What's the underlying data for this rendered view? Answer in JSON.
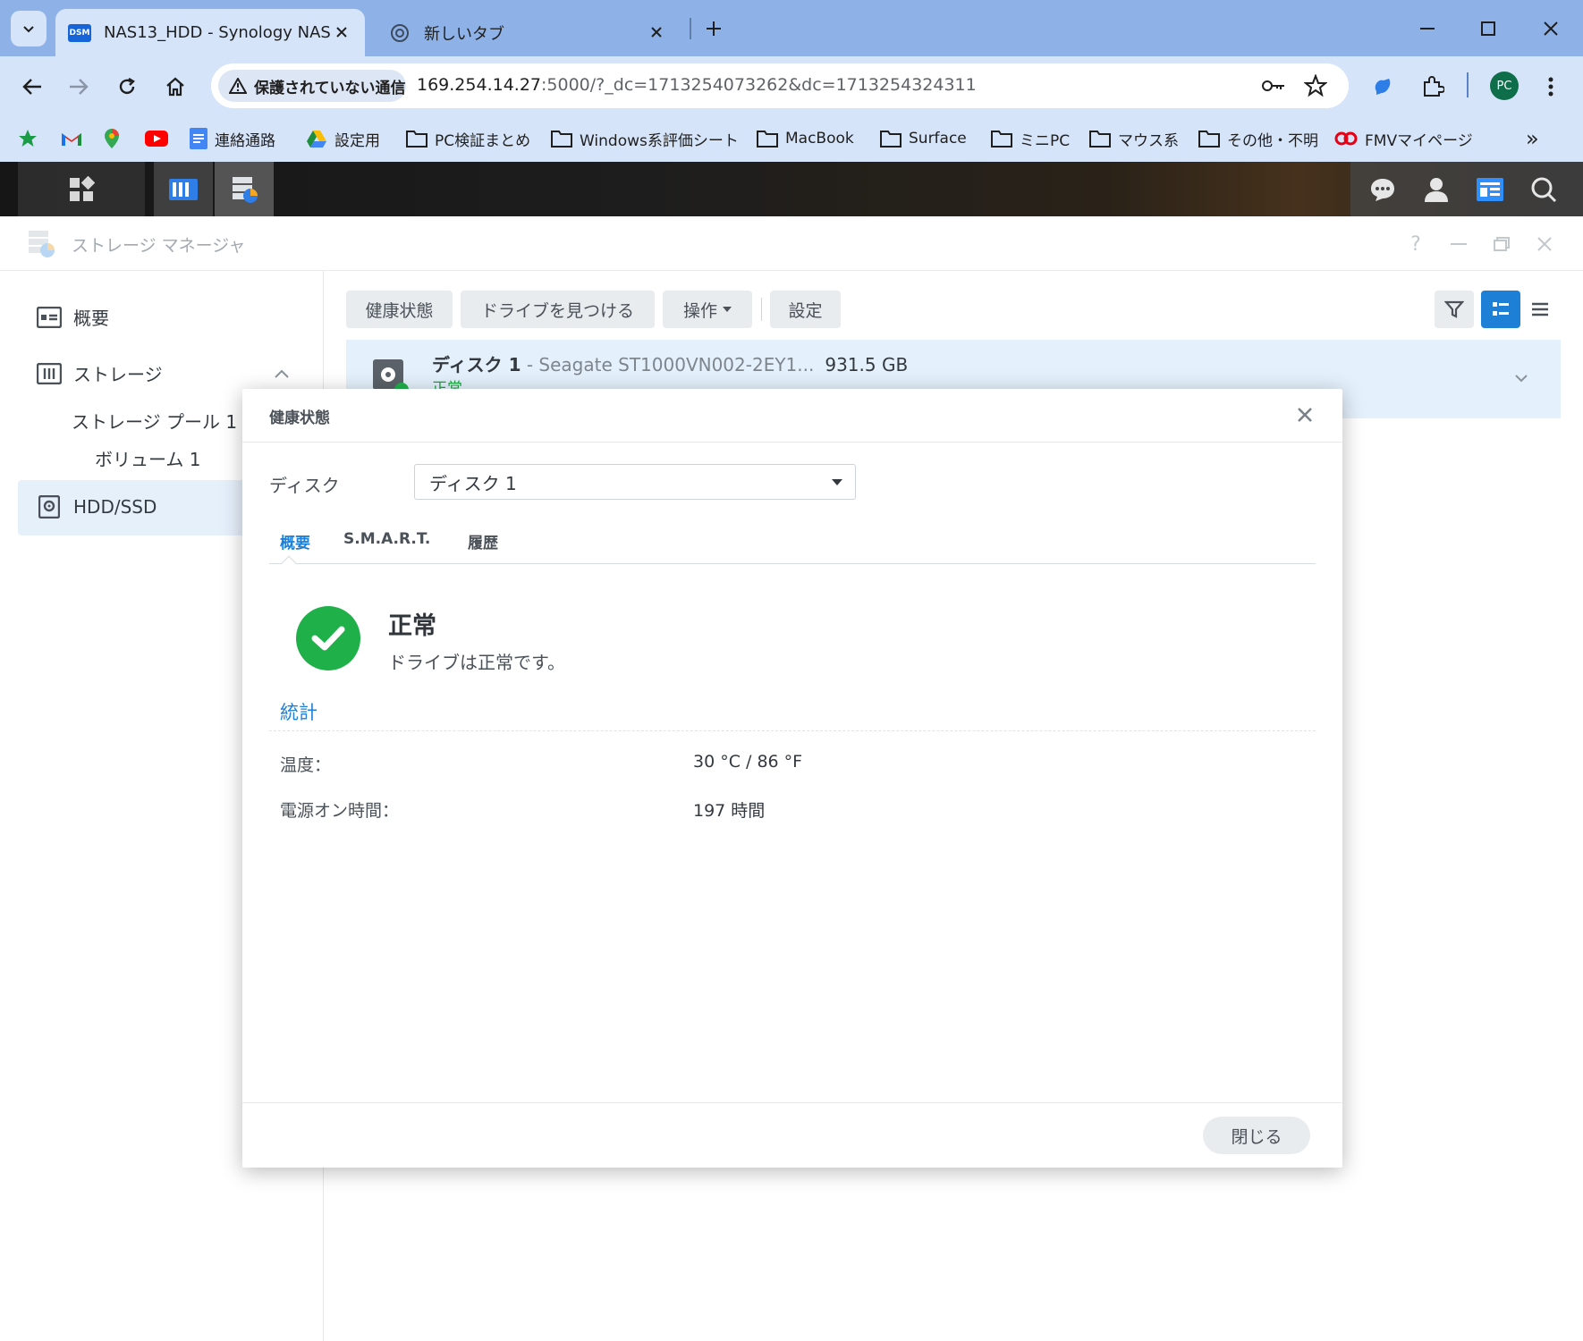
{
  "browser": {
    "tabs": [
      {
        "favicon": "DSM",
        "title": "NAS13_HDD - Synology NAS",
        "active": true
      },
      {
        "title": "新しいタブ",
        "active": false
      }
    ],
    "security_chip": "保護されていない通信",
    "url_host": "169.254.14.27",
    "url_rest": ":5000/?_dc=1713254073262&dc=1713254324311",
    "profile_initials": "PC",
    "bookmarks": [
      {
        "label": "",
        "icon": "star-icon"
      },
      {
        "label": "",
        "icon": "gmail-icon"
      },
      {
        "label": "",
        "icon": "maps-icon"
      },
      {
        "label": "",
        "icon": "youtube-icon"
      },
      {
        "label": "連絡通路",
        "icon": "docs-icon"
      },
      {
        "label": "設定用",
        "icon": "drive-icon"
      },
      {
        "label": "PC検証まとめ",
        "icon": "folder-icon"
      },
      {
        "label": "Windows系評価シート",
        "icon": "folder-icon"
      },
      {
        "label": "MacBook",
        "icon": "folder-icon"
      },
      {
        "label": "Surface",
        "icon": "folder-icon"
      },
      {
        "label": "ミニPC",
        "icon": "folder-icon"
      },
      {
        "label": "マウス系",
        "icon": "folder-icon"
      },
      {
        "label": "その他・不明",
        "icon": "folder-icon"
      },
      {
        "label": "FMVマイページ",
        "icon": "fmv-icon"
      }
    ],
    "more_bookmarks": "»"
  },
  "storage_manager": {
    "title": "ストレージ マネージャ",
    "help": "?",
    "sidebar": {
      "overview": "概要",
      "storage": "ストレージ",
      "pool": "ストレージ プール 1",
      "volume": "ボリューム 1",
      "hdd": "HDD/SSD"
    },
    "toolbar": {
      "health": "健康状態",
      "find_drive": "ドライブを見つける",
      "actions": "操作",
      "settings": "設定"
    },
    "disk": {
      "name": "ディスク 1",
      "separator": " - ",
      "model": "Seagate ST1000VN002-2EY1...",
      "capacity": "931.5 GB",
      "status": "正常"
    }
  },
  "modal": {
    "title": "健康状態",
    "disk_label": "ディスク",
    "disk_value": "ディスク 1",
    "tabs": [
      "概要",
      "S.M.A.R.T.",
      "履歴"
    ],
    "status_title": "正常",
    "status_desc": "ドライブは正常です。",
    "stats_title": "統計",
    "stats": [
      {
        "key": "温度：",
        "value": "30 °C / 86 °F"
      },
      {
        "key": "電源オン時間：",
        "value": "197 時間"
      }
    ],
    "close_button": "閉じる"
  },
  "colors": {
    "accent": "#1e7fd6",
    "ok_green": "#1fb04a",
    "browser_frame": "#8eb2e8"
  }
}
